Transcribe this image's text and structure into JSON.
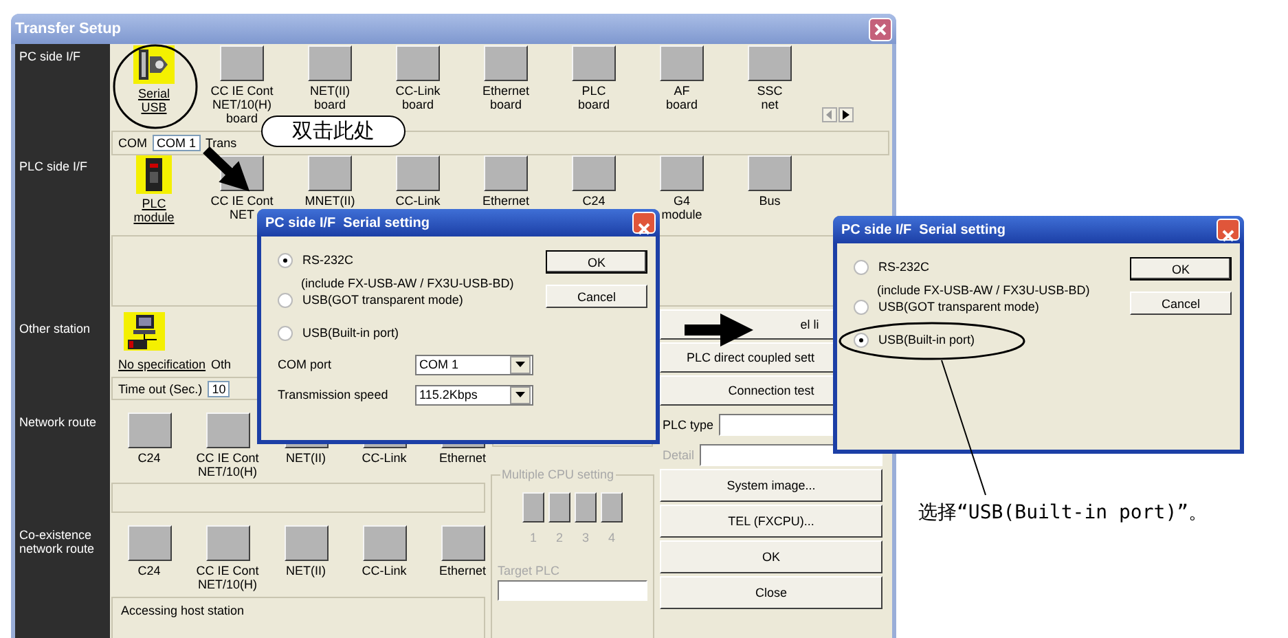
{
  "window": {
    "title": "Transfer Setup"
  },
  "pc_side": {
    "label": "PC side I/F",
    "items": [
      {
        "kind": "serial",
        "lines": [
          "Serial",
          "USB"
        ],
        "selected": true
      },
      {
        "kind": "board",
        "lines": [
          "CC IE Cont",
          "NET/10(H)",
          "board"
        ],
        "selected": false
      },
      {
        "kind": "board",
        "lines": [
          "NET(II)",
          "board"
        ],
        "selected": false
      },
      {
        "kind": "board",
        "lines": [
          "CC-Link",
          "board"
        ],
        "selected": false
      },
      {
        "kind": "board",
        "lines": [
          "Ethernet",
          "board"
        ],
        "selected": false
      },
      {
        "kind": "board",
        "lines": [
          "PLC",
          "board"
        ],
        "selected": false
      },
      {
        "kind": "board",
        "lines": [
          "AF",
          "board"
        ],
        "selected": false
      },
      {
        "kind": "board",
        "lines": [
          "SSC",
          "net"
        ],
        "selected": false
      }
    ],
    "com": {
      "label": "COM",
      "value": "COM 1",
      "info": "Trans"
    }
  },
  "plc_side": {
    "label": "PLC side I/F",
    "items": [
      {
        "kind": "plc",
        "lines": [
          "PLC",
          "module"
        ],
        "selected": true
      },
      {
        "kind": "board",
        "lines": [
          "CC IE Cont",
          "NET"
        ],
        "selected": false
      },
      {
        "kind": "board",
        "lines": [
          "MNET(II)"
        ],
        "selected": false
      },
      {
        "kind": "board",
        "lines": [
          "CC-Link"
        ],
        "selected": false
      },
      {
        "kind": "board",
        "lines": [
          "Ethernet"
        ],
        "selected": false
      },
      {
        "kind": "board",
        "lines": [
          "C24"
        ],
        "selected": false
      },
      {
        "kind": "board",
        "lines": [
          "G4",
          "module"
        ],
        "selected": false
      },
      {
        "kind": "board",
        "lines": [
          "Bus"
        ],
        "selected": false
      }
    ]
  },
  "other_station": {
    "label": "Other station",
    "option": "No specification",
    "option_2": "Oth",
    "timeout_label": "Time out (Sec.)",
    "timeout_value": "10"
  },
  "network_route": {
    "label": "Network route",
    "items": [
      {
        "lines": [
          "C24"
        ]
      },
      {
        "lines": [
          "CC IE Cont",
          "NET/10(H)"
        ]
      },
      {
        "lines": [
          "NET(II)"
        ]
      },
      {
        "lines": [
          "CC-Link"
        ]
      },
      {
        "lines": [
          "Ethernet"
        ]
      }
    ]
  },
  "coexistence_route": {
    "label": "Co-existence network route",
    "items": [
      {
        "lines": [
          "C24"
        ]
      },
      {
        "lines": [
          "CC IE Cont",
          "NET/10(H)"
        ]
      },
      {
        "lines": [
          "NET(II)"
        ]
      },
      {
        "lines": [
          "CC-Link"
        ]
      },
      {
        "lines": [
          "Ethernet"
        ]
      }
    ],
    "status": "Accessing host station"
  },
  "multiple_cpu": {
    "title": "Multiple CPU setting",
    "cpus": [
      "1",
      "2",
      "3",
      "4"
    ],
    "target_label": "Target PLC"
  },
  "side_buttons": [
    "el  li",
    "PLC direct coupled sett",
    "Connection test"
  ],
  "plc_type": {
    "label": "PLC type",
    "detail_label": "Detail"
  },
  "bottom_buttons": [
    "System   image...",
    "TEL (FXCPU)...",
    "OK",
    "Close"
  ],
  "dialogs": [
    {
      "title": "PC side I/F  Serial setting",
      "options": [
        {
          "label": "RS-232C",
          "note": "(include FX-USB-AW / FX3U-USB-BD)",
          "selected": true
        },
        {
          "label": "USB(GOT transparent mode)",
          "selected": false
        },
        {
          "label": "USB(Built-in port)",
          "selected": false
        }
      ],
      "buttons": [
        "OK",
        "Cancel"
      ],
      "fields": [
        {
          "label": "COM port",
          "value": "COM 1"
        },
        {
          "label": "Transmission speed",
          "value": "115.2Kbps"
        }
      ]
    },
    {
      "title": "PC side I/F  Serial setting",
      "options": [
        {
          "label": "RS-232C",
          "note": "(include FX-USB-AW / FX3U-USB-BD)",
          "selected": false
        },
        {
          "label": "USB(GOT transparent mode)",
          "selected": false
        },
        {
          "label": "USB(Built-in port)",
          "selected": true
        }
      ],
      "buttons": [
        "OK",
        "Cancel"
      ]
    }
  ],
  "annotations": {
    "callout": "双击此处",
    "caption": "选择“USB(Built-in port)”。"
  }
}
